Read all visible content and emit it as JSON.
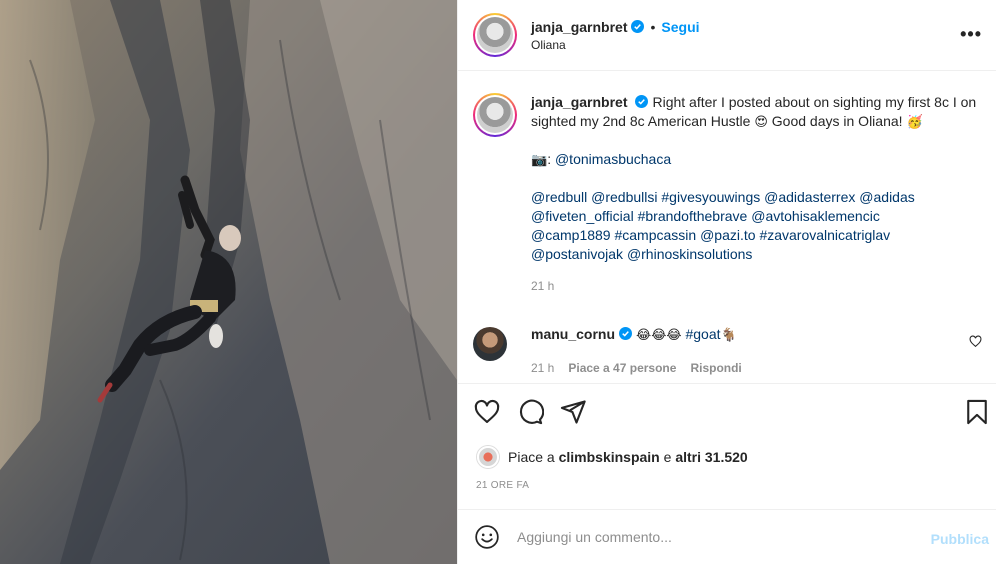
{
  "post": {
    "username": "janja_garnbret",
    "follow_label": "Segui",
    "dot": "•",
    "location": "Oliana",
    "more_label": "•••"
  },
  "caption": {
    "username": "janja_garnbret",
    "text_1": "Right after I posted about on sighting my first 8c I on sighted my 2nd 8c American Hustle",
    "emoji_1": "😍",
    "text_2": "Good days in Oliana!",
    "emoji_2": "🥳",
    "camera": "📷",
    "photo_credit_prefix": ":",
    "photo_credit": "@tonimasbuchaca",
    "tags": [
      "@redbull",
      "@redbullsi",
      "#givesyouwings",
      "@adidasterrex",
      "@adidas",
      "@fiveten_official",
      "#brandofthebrave",
      "@avtohisaklemencic",
      "@camp1889",
      "#campcassin",
      "@pazi.to",
      "#zavarovalnicatriglav",
      "@postanivojak",
      "@rhinoskinsolutions"
    ],
    "time": "21 h"
  },
  "comment": {
    "username": "manu_cornu",
    "emojis": "😂😂😂",
    "tag": "#goat",
    "emoji_goat": "🐐",
    "time": "21 h",
    "likes": "Piace a 47 persone",
    "reply": "Rispondi"
  },
  "likes": {
    "prefix": "Piace a",
    "user": "climbskinspain",
    "middle": "e",
    "others": "altri 31.520"
  },
  "time_ago": "21 ORE FA",
  "add_comment": {
    "placeholder": "Aggiungi un commento...",
    "publish": "Pubblica"
  },
  "colors": {
    "accent": "#0095f6",
    "link": "#00376b",
    "muted": "#8e8e8e",
    "publish_disabled": "#b2dffc"
  }
}
